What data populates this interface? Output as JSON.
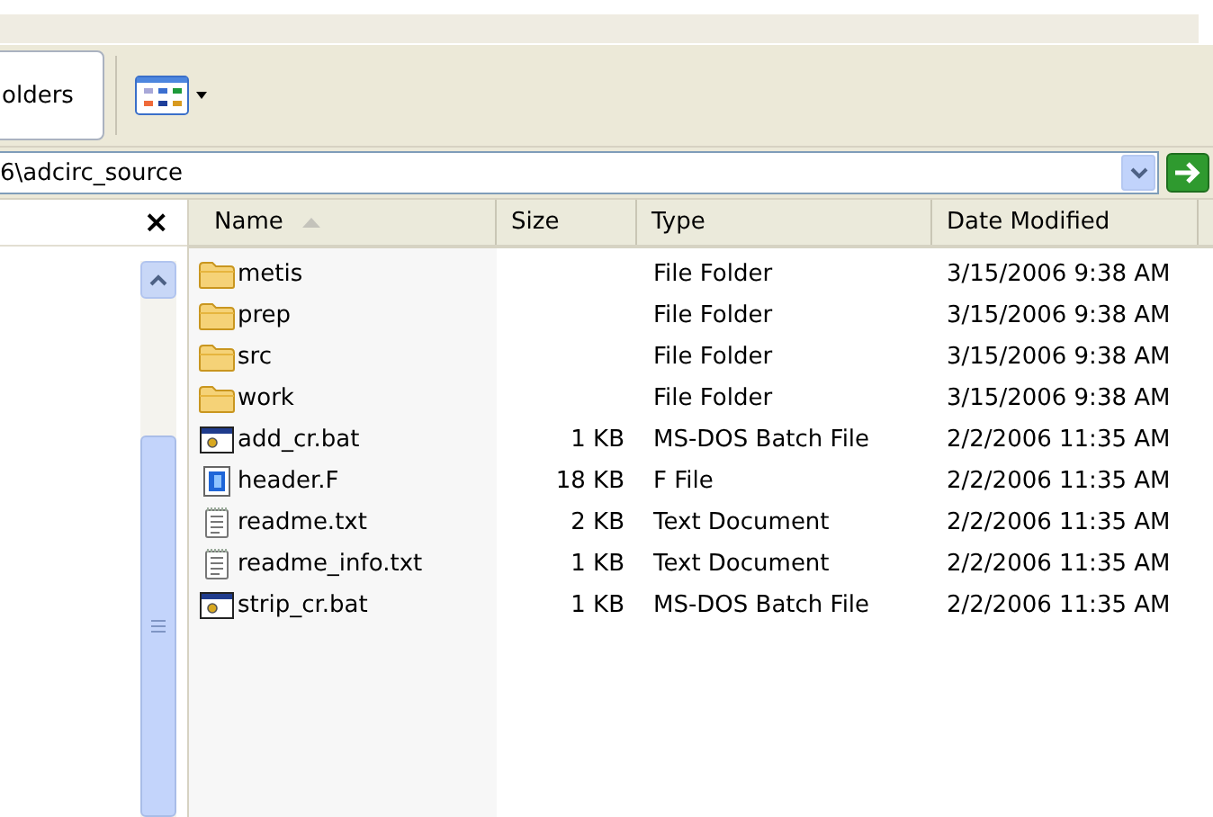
{
  "toolbar": {
    "folders_button": "olders"
  },
  "address": {
    "value": "6\\adcirc_source"
  },
  "left_pane": {
    "close": "×"
  },
  "columns": [
    {
      "label": "Name",
      "sorted": true
    },
    {
      "label": "Size",
      "sorted": false
    },
    {
      "label": "Type",
      "sorted": false
    },
    {
      "label": "Date Modified",
      "sorted": false
    }
  ],
  "files": [
    {
      "name": "metis",
      "kind": "folder",
      "type": "File Folder",
      "modified": "3/15/2006 9:38 AM"
    },
    {
      "name": "prep",
      "kind": "folder",
      "type": "File Folder",
      "modified": "3/15/2006 9:38 AM"
    },
    {
      "name": "src",
      "kind": "folder",
      "type": "File Folder",
      "modified": "3/15/2006 9:38 AM"
    },
    {
      "name": "work",
      "kind": "folder",
      "type": "File Folder",
      "modified": "3/15/2006 9:38 AM"
    },
    {
      "name": "add_cr.bat",
      "kind": "batch",
      "size": "1 KB",
      "type": "MS-DOS Batch File",
      "modified": "2/2/2006 11:35 AM"
    },
    {
      "name": "header.F",
      "kind": "source",
      "size": "18 KB",
      "type": "F File",
      "modified": "2/2/2006 11:35 AM"
    },
    {
      "name": "readme.txt",
      "kind": "text",
      "size": "2 KB",
      "type": "Text Document",
      "modified": "2/2/2006 11:35 AM"
    },
    {
      "name": "readme_info.txt",
      "kind": "text",
      "size": "1 KB",
      "type": "Text Document",
      "modified": "2/2/2006 11:35 AM"
    },
    {
      "name": "strip_cr.bat",
      "kind": "batch",
      "size": "1 KB",
      "type": "MS-DOS Batch File",
      "modified": "2/2/2006 11:35 AM"
    }
  ]
}
